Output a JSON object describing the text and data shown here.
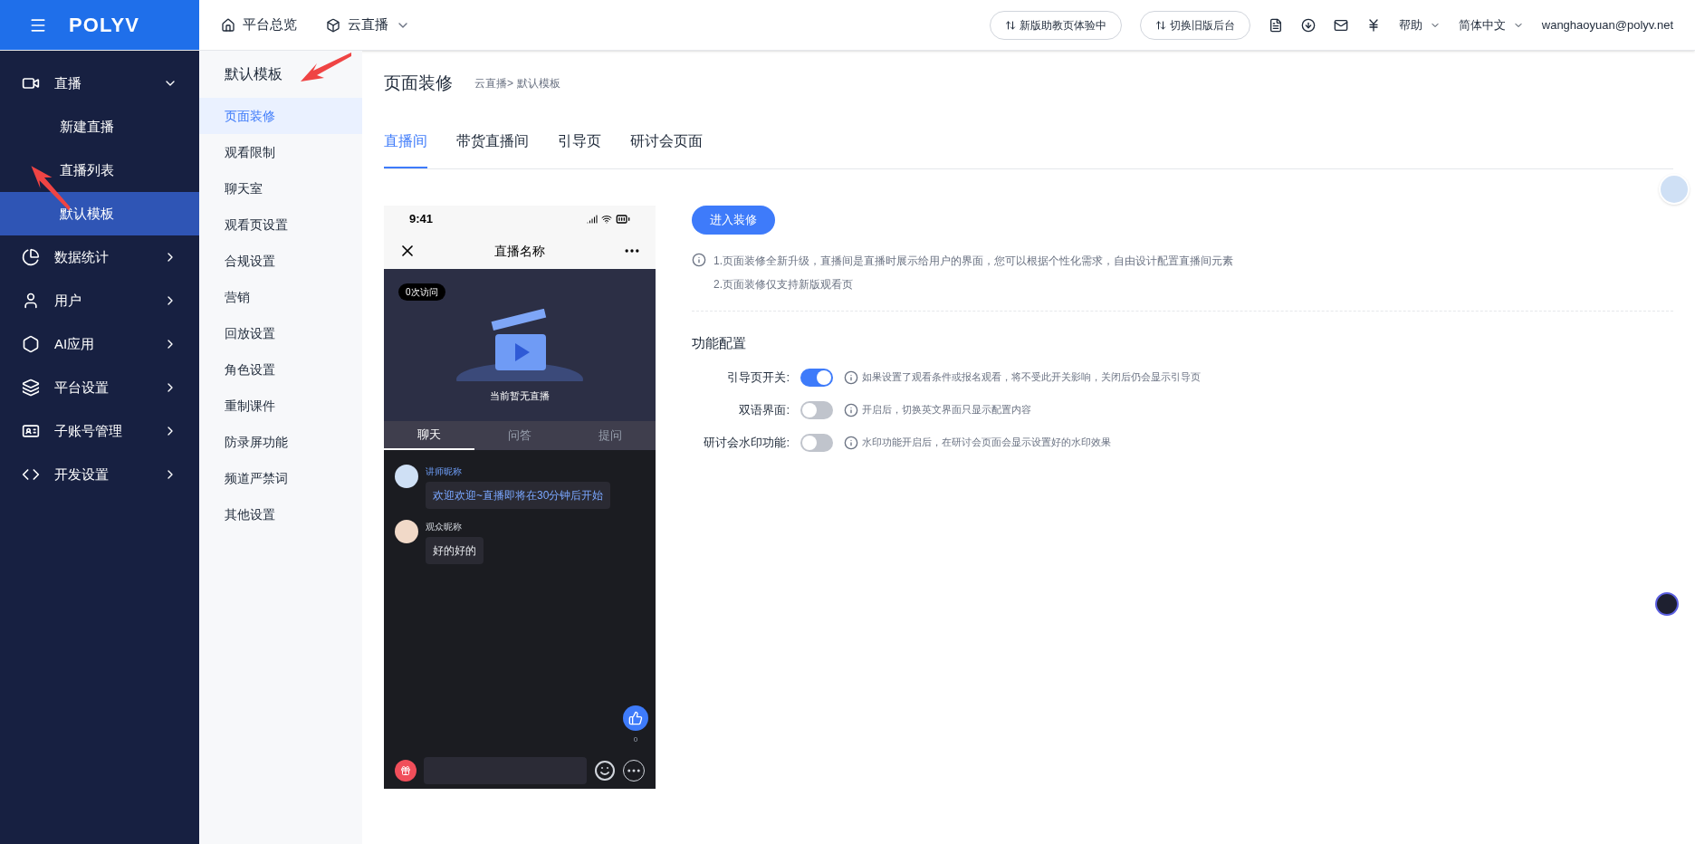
{
  "topbar": {
    "logo": "POLYV",
    "nav": [
      "平台总览",
      "云直播"
    ],
    "actions": [
      {
        "label": "新版助教页体验中"
      },
      {
        "label": "切换旧版后台"
      }
    ],
    "menus": [
      "帮助",
      "简体中文"
    ],
    "user": "wanghaoyuan@polyv.net"
  },
  "sidebar": {
    "items": [
      {
        "label": "直播",
        "expanded": true,
        "children": [
          {
            "label": "新建直播",
            "selected": false
          },
          {
            "label": "直播列表",
            "selected": false
          },
          {
            "label": "默认模板",
            "selected": true
          }
        ]
      },
      {
        "label": "数据统计",
        "expanded": false
      },
      {
        "label": "用户",
        "expanded": false
      },
      {
        "label": "AI应用",
        "expanded": false
      },
      {
        "label": "平台设置",
        "expanded": false
      },
      {
        "label": "子账号管理",
        "expanded": false
      },
      {
        "label": "开发设置",
        "expanded": false
      }
    ]
  },
  "submenu": {
    "title": "默认模板",
    "items": [
      {
        "label": "页面装修",
        "selected": true
      },
      {
        "label": "观看限制",
        "selected": false
      },
      {
        "label": "聊天室",
        "selected": false
      },
      {
        "label": "观看页设置",
        "selected": false
      },
      {
        "label": "合规设置",
        "selected": false
      },
      {
        "label": "营销",
        "selected": false
      },
      {
        "label": "回放设置",
        "selected": false
      },
      {
        "label": "角色设置",
        "selected": false
      },
      {
        "label": "重制课件",
        "selected": false
      },
      {
        "label": "防录屏功能",
        "selected": false
      },
      {
        "label": "频道严禁词",
        "selected": false
      },
      {
        "label": "其他设置",
        "selected": false
      }
    ]
  },
  "page": {
    "title": "页面装修",
    "breadcrumb": [
      "云直播>",
      "默认模板"
    ],
    "tabs": [
      {
        "label": "直播间",
        "selected": true
      },
      {
        "label": "带货直播间",
        "selected": false
      },
      {
        "label": "引导页",
        "selected": false
      },
      {
        "label": "研讨会页面",
        "selected": false
      }
    ],
    "phone": {
      "time": "9:41",
      "title": "直播名称",
      "visits": "0次访问",
      "status": "当前暂无直播",
      "tabs": [
        {
          "label": "聊天",
          "selected": true
        },
        {
          "label": "问答",
          "selected": false
        },
        {
          "label": "提问",
          "selected": false
        }
      ],
      "messages": [
        {
          "name": "讲师昵称",
          "text": "欢迎欢迎~直播即将在30分钟后开始",
          "kind": "teacher"
        },
        {
          "name": "观众昵称",
          "text": "好的好的",
          "kind": "viewer"
        }
      ],
      "likes": "0"
    },
    "enter_button": "进入装修",
    "notes": [
      "1.页面装修全新升级，直播间是直播时展示给用户的界面，您可以根据个性化需求，自由设计配置直播间元素",
      "2.页面装修仅支持新版观看页"
    ],
    "section_title": "功能配置",
    "settings": [
      {
        "label": "引导页开关:",
        "on": true,
        "hint": "如果设置了观看条件或报名观看，将不受此开关影响，关闭后仍会显示引导页"
      },
      {
        "label": "双语界面:",
        "on": false,
        "hint": "开启后，切换英文界面只显示配置内容"
      },
      {
        "label": "研讨会水印功能:",
        "on": false,
        "hint": "水印功能开启后，在研讨会页面会显示设置好的水印效果"
      }
    ]
  }
}
